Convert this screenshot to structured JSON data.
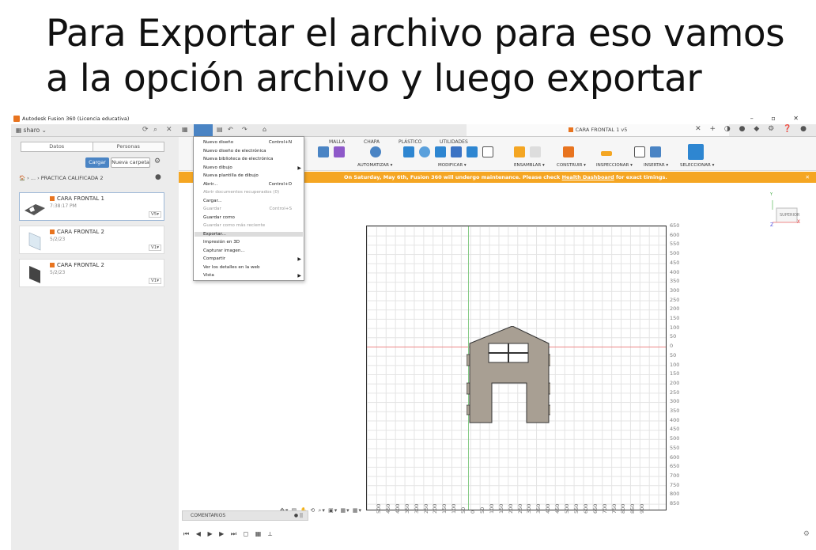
{
  "heading": {
    "line1": "Para Exportar el archivo para eso vamos",
    "line2": "a la  opción archivo y luego exportar"
  },
  "window": {
    "title": "Autodesk Fusion 360 (Licencia educativa)",
    "controls": "–  ▫  ✕"
  },
  "data_panel": {
    "user": "sharo",
    "tabs": [
      "Datos",
      "Personas"
    ],
    "upload_label": "Cargar",
    "new_folder_label": "Nueva carpeta",
    "breadcrumb": "› ... › PRACTICA CALIFICADA 2",
    "files": [
      {
        "name": "CARA FRONTAL 1",
        "date": "7:38:17 PM",
        "version": "V5▾"
      },
      {
        "name": "CARA FRONTAL 2",
        "date": "5/2/23",
        "version": "V1▾"
      },
      {
        "name": "CARA FRONTAL 2",
        "date": "5/2/23",
        "version": "V1▾"
      }
    ]
  },
  "document_tab": "CARA FRONTAL 1 v5",
  "ribbon": {
    "tabs": [
      "MALLA",
      "CHAPA",
      "PLÁSTICO",
      "UTILIDADES"
    ],
    "groups": [
      "AUTOMATIZAR ▾",
      "MODIFICAR ▾",
      "ENSAMBLAR ▾",
      "CONSTRUIR ▾",
      "INSPECCIONAR ▾",
      "INSERTAR ▾",
      "SELECCIONAR ▾"
    ]
  },
  "banner": {
    "text_before": "On Saturday, May 6th, Fusion 360 will undergo maintenance. Please check ",
    "link": "Health Dashboard",
    "text_after": " for exact timings.",
    "close": "✕"
  },
  "file_menu": {
    "items": [
      {
        "label": "Nuevo diseño",
        "shortcut": "Control+N",
        "disabled": false
      },
      {
        "label": "Nuevo diseño de electrónica",
        "shortcut": "",
        "disabled": false
      },
      {
        "label": "Nueva biblioteca de electrónica",
        "shortcut": "",
        "disabled": false
      },
      {
        "label": "Nuevo dibujo",
        "shortcut": "",
        "disabled": false,
        "submenu": true
      },
      {
        "label": "Nueva plantilla de dibujo",
        "shortcut": "",
        "disabled": false
      },
      {
        "label": "Abrir...",
        "shortcut": "Control+O",
        "disabled": false
      },
      {
        "label": "Abrir documentos recuperados (0)",
        "shortcut": "",
        "disabled": true
      },
      {
        "label": "Cargar...",
        "shortcut": "",
        "disabled": false
      },
      {
        "label": "Guardar",
        "shortcut": "Control+S",
        "disabled": true
      },
      {
        "label": "Guardar como",
        "shortcut": "",
        "disabled": false
      },
      {
        "label": "Guardar como más reciente",
        "shortcut": "",
        "disabled": true
      },
      {
        "label": "Exportar...",
        "shortcut": "",
        "disabled": false,
        "highlighted": true
      },
      {
        "label": "Impresión en 3D",
        "shortcut": "",
        "disabled": false
      },
      {
        "label": "Capturar imagen...",
        "shortcut": "",
        "disabled": false
      },
      {
        "label": "Compartir",
        "shortcut": "",
        "disabled": false,
        "submenu": true
      },
      {
        "label": "Ver los detalles en la web",
        "shortcut": "",
        "disabled": false
      },
      {
        "label": "Vista",
        "shortcut": "",
        "disabled": false,
        "submenu": true
      }
    ]
  },
  "viewcube": {
    "face": "SUPERIOR",
    "axis_x": "X",
    "axis_y": "Y",
    "axis_z": "Z"
  },
  "grid": {
    "y_labels": [
      "650",
      "600",
      "550",
      "500",
      "450",
      "400",
      "350",
      "300",
      "250",
      "200",
      "150",
      "100",
      "50",
      "0",
      "50",
      "100",
      "150",
      "200",
      "250",
      "300",
      "350",
      "400",
      "450",
      "500",
      "550",
      "600",
      "650",
      "700",
      "750",
      "800",
      "850"
    ],
    "x_labels": [
      "500",
      "450",
      "400",
      "350",
      "300",
      "250",
      "200",
      "150",
      "100",
      "50",
      "0",
      "50",
      "100",
      "150",
      "200",
      "250",
      "300",
      "350",
      "400",
      "450",
      "500",
      "550",
      "600",
      "650",
      "700",
      "750",
      "800",
      "850",
      "900"
    ]
  },
  "comments_label": "COMENTARIOS",
  "colors": {
    "accent": "#4a84c4",
    "banner": "#f5a623",
    "model": "#a89f93",
    "fusion_orange": "#e8741f"
  }
}
